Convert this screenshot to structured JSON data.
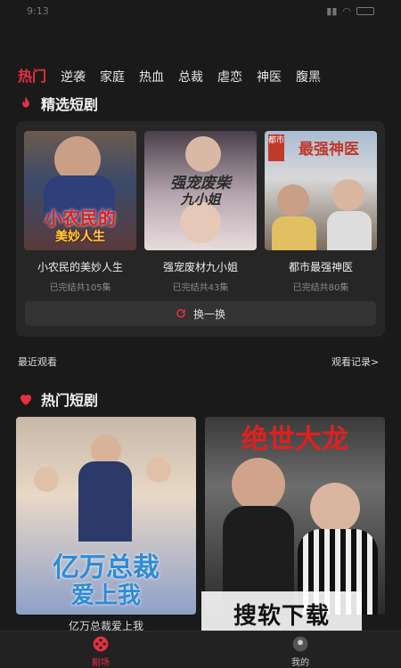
{
  "status": {
    "time": "9:13"
  },
  "tabs": [
    "热门",
    "逆袭",
    "家庭",
    "热血",
    "总裁",
    "虐恋",
    "神医",
    "腹黑"
  ],
  "featured": {
    "title": "精选短剧",
    "dramas": [
      {
        "title": "小农民的美妙人生",
        "status": "已完结共105集",
        "poster_caption": "小农民的",
        "poster_caption2": "美妙人生"
      },
      {
        "title": "强宠废材九小姐",
        "status": "已完结共43集",
        "poster_caption": "强宠废柴",
        "poster_caption2": "九小姐"
      },
      {
        "title": "都市最强神医",
        "status": "已完结共80集",
        "poster_caption": "最强神医",
        "poster_badge": "都市"
      }
    ],
    "refresh_label": "换一换"
  },
  "recent": {
    "label": "最近观看",
    "history_link": "观看记录>"
  },
  "hot": {
    "title": "热门短剧",
    "items": [
      {
        "title": "亿万总裁爱上我",
        "poster_caption": "亿万总裁",
        "poster_caption2": "爱上我"
      },
      {
        "title": "",
        "poster_caption": "绝世大龙"
      }
    ]
  },
  "watermark": "搜软下载",
  "nav": {
    "home_label": "剧场",
    "profile_label": "我的"
  },
  "colors": {
    "accent": "#e8313f",
    "background": "#1a1a1a",
    "card": "#262626"
  }
}
